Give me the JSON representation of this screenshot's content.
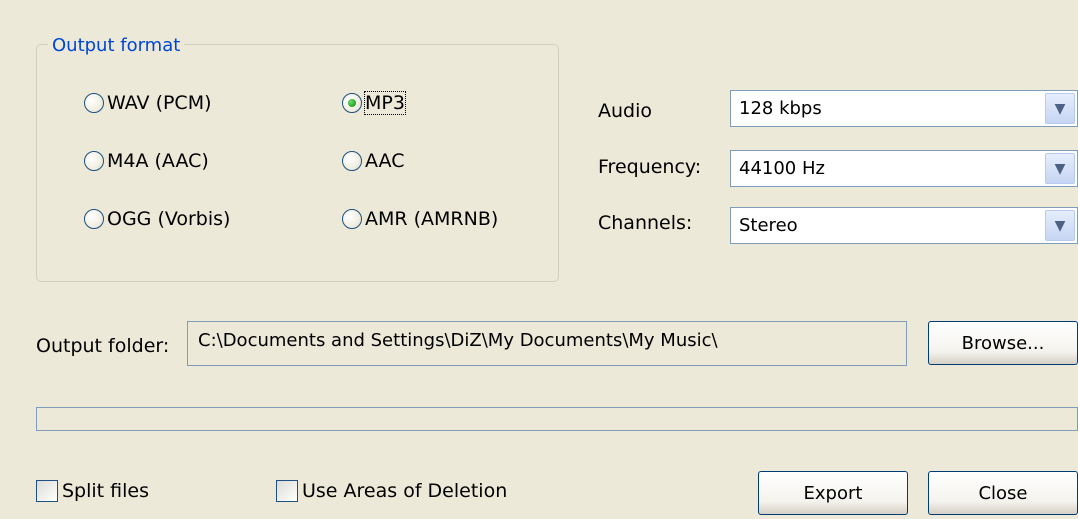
{
  "output_format": {
    "title": "Output format",
    "options": [
      {
        "label": "WAV (PCM)",
        "selected": false
      },
      {
        "label": "MP3",
        "selected": true
      },
      {
        "label": "M4A (AAC)",
        "selected": false
      },
      {
        "label": "AAC",
        "selected": false
      },
      {
        "label": "OGG (Vorbis)",
        "selected": false
      },
      {
        "label": "AMR (AMRNB)",
        "selected": false
      }
    ]
  },
  "settings": {
    "audio_label": "Audio",
    "audio_value": "128 kbps",
    "frequency_label": "Frequency:",
    "frequency_value": "44100 Hz",
    "channels_label": "Channels:",
    "channels_value": "Stereo",
    "dropdown_icon": "chevron-down-icon"
  },
  "output_folder": {
    "label": "Output folder:",
    "value": "C:\\Documents and Settings\\DiZ\\My Documents\\My Music\\",
    "browse_label": "Browse..."
  },
  "progress": {
    "value": 0
  },
  "bottom": {
    "split_files_label": "Split files",
    "split_files_checked": false,
    "areas_label": "Use Areas of Deletion",
    "areas_checked": false,
    "export_label": "Export",
    "close_label": "Close"
  },
  "colors": {
    "background": "#ece9d8",
    "group_title": "#0046d5",
    "border": "#7f9db9"
  }
}
